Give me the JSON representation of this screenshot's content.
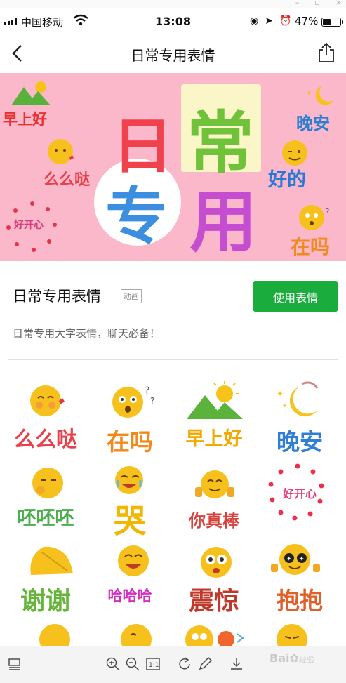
{
  "status_bar": {
    "carrier": "中国移动",
    "time": "13:08",
    "battery": "47%",
    "battery_level": 0.47
  },
  "navbar": {
    "title": "日常专用表情"
  },
  "banner": {
    "chars": [
      "日",
      "常",
      "专",
      "用"
    ],
    "stickers": [
      "早上好",
      "么么哒",
      "好开心",
      "晚安",
      "好的",
      "在吗"
    ]
  },
  "pack": {
    "title": "日常专用表情",
    "tag": "动画",
    "button": "使用表情",
    "description": "日常专用大字表情，聊天必备！"
  },
  "stickers": [
    {
      "label": "么么哒",
      "color": "#e8414b"
    },
    {
      "label": "在吗",
      "color": "#f08a1c"
    },
    {
      "label": "早上好",
      "color": "#f2a900"
    },
    {
      "label": "晚安",
      "color": "#2f7fd6"
    },
    {
      "label": "呸呸呸",
      "color": "#4cae4f"
    },
    {
      "label": "哭",
      "color": "#f3b600"
    },
    {
      "label": "你真棒",
      "color": "#d7423c"
    },
    {
      "label": "好开心",
      "color": "#e0407a"
    },
    {
      "label": "谢谢",
      "color": "#66b43a"
    },
    {
      "label": "哈哈哈",
      "color": "#d12fc0"
    },
    {
      "label": "震惊",
      "color": "#c0392b"
    },
    {
      "label": "抱抱",
      "color": "#e0602a"
    }
  ],
  "watermark": {
    "brand": "Bai",
    "sub": "经验"
  },
  "colors": {
    "accent": "#1aad3e",
    "banner_bg": "#fbb8cb"
  },
  "icons": [
    "back-icon",
    "share-icon",
    "zoom-in-icon",
    "zoom-out-icon",
    "actual-size-icon",
    "rotate-icon",
    "edit-icon",
    "download-icon",
    "thumbnail-icon"
  ]
}
